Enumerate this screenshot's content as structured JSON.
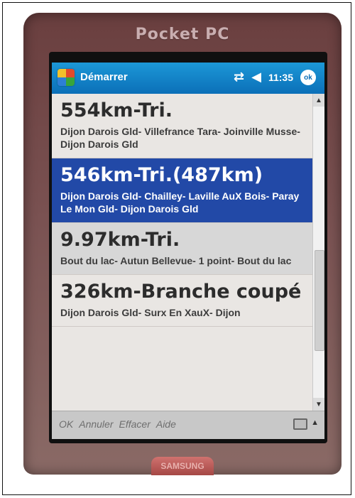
{
  "device": {
    "brand": "Pocket PC",
    "button_label": "SAMSUNG"
  },
  "titlebar": {
    "start_label": "Démarrer",
    "time": "11:35",
    "ok_label": "ok",
    "icons": [
      "windows-start-icon",
      "connectivity-icon",
      "volume-icon",
      "ok-icon"
    ]
  },
  "items": [
    {
      "title": "554km-Tri.",
      "route": "Dijon Darois Gld- Villefrance Tara- Joinville Musse- Dijon Darois Gld"
    },
    {
      "title": "546km-Tri.(487km)",
      "route": "Dijon Darois Gld- Chailley- Laville AuX Bois- Paray Le Mon Gld- Dijon Darois Gld",
      "selected": true
    },
    {
      "title": "9.97km-Tri.",
      "route": "Bout du lac- Autun Bellevue- 1 point- Bout du lac"
    },
    {
      "title": "326km-Branche coupé",
      "route": "Dijon Darois Gld- Surx En XauX- Dijon"
    }
  ],
  "menu": {
    "items": [
      "OK",
      "Annuler",
      "Effacer",
      "Aide"
    ]
  },
  "colors": {
    "titlebar": "#0b6fb8",
    "selection": "#2249a7",
    "device": "#6a3f3f"
  }
}
